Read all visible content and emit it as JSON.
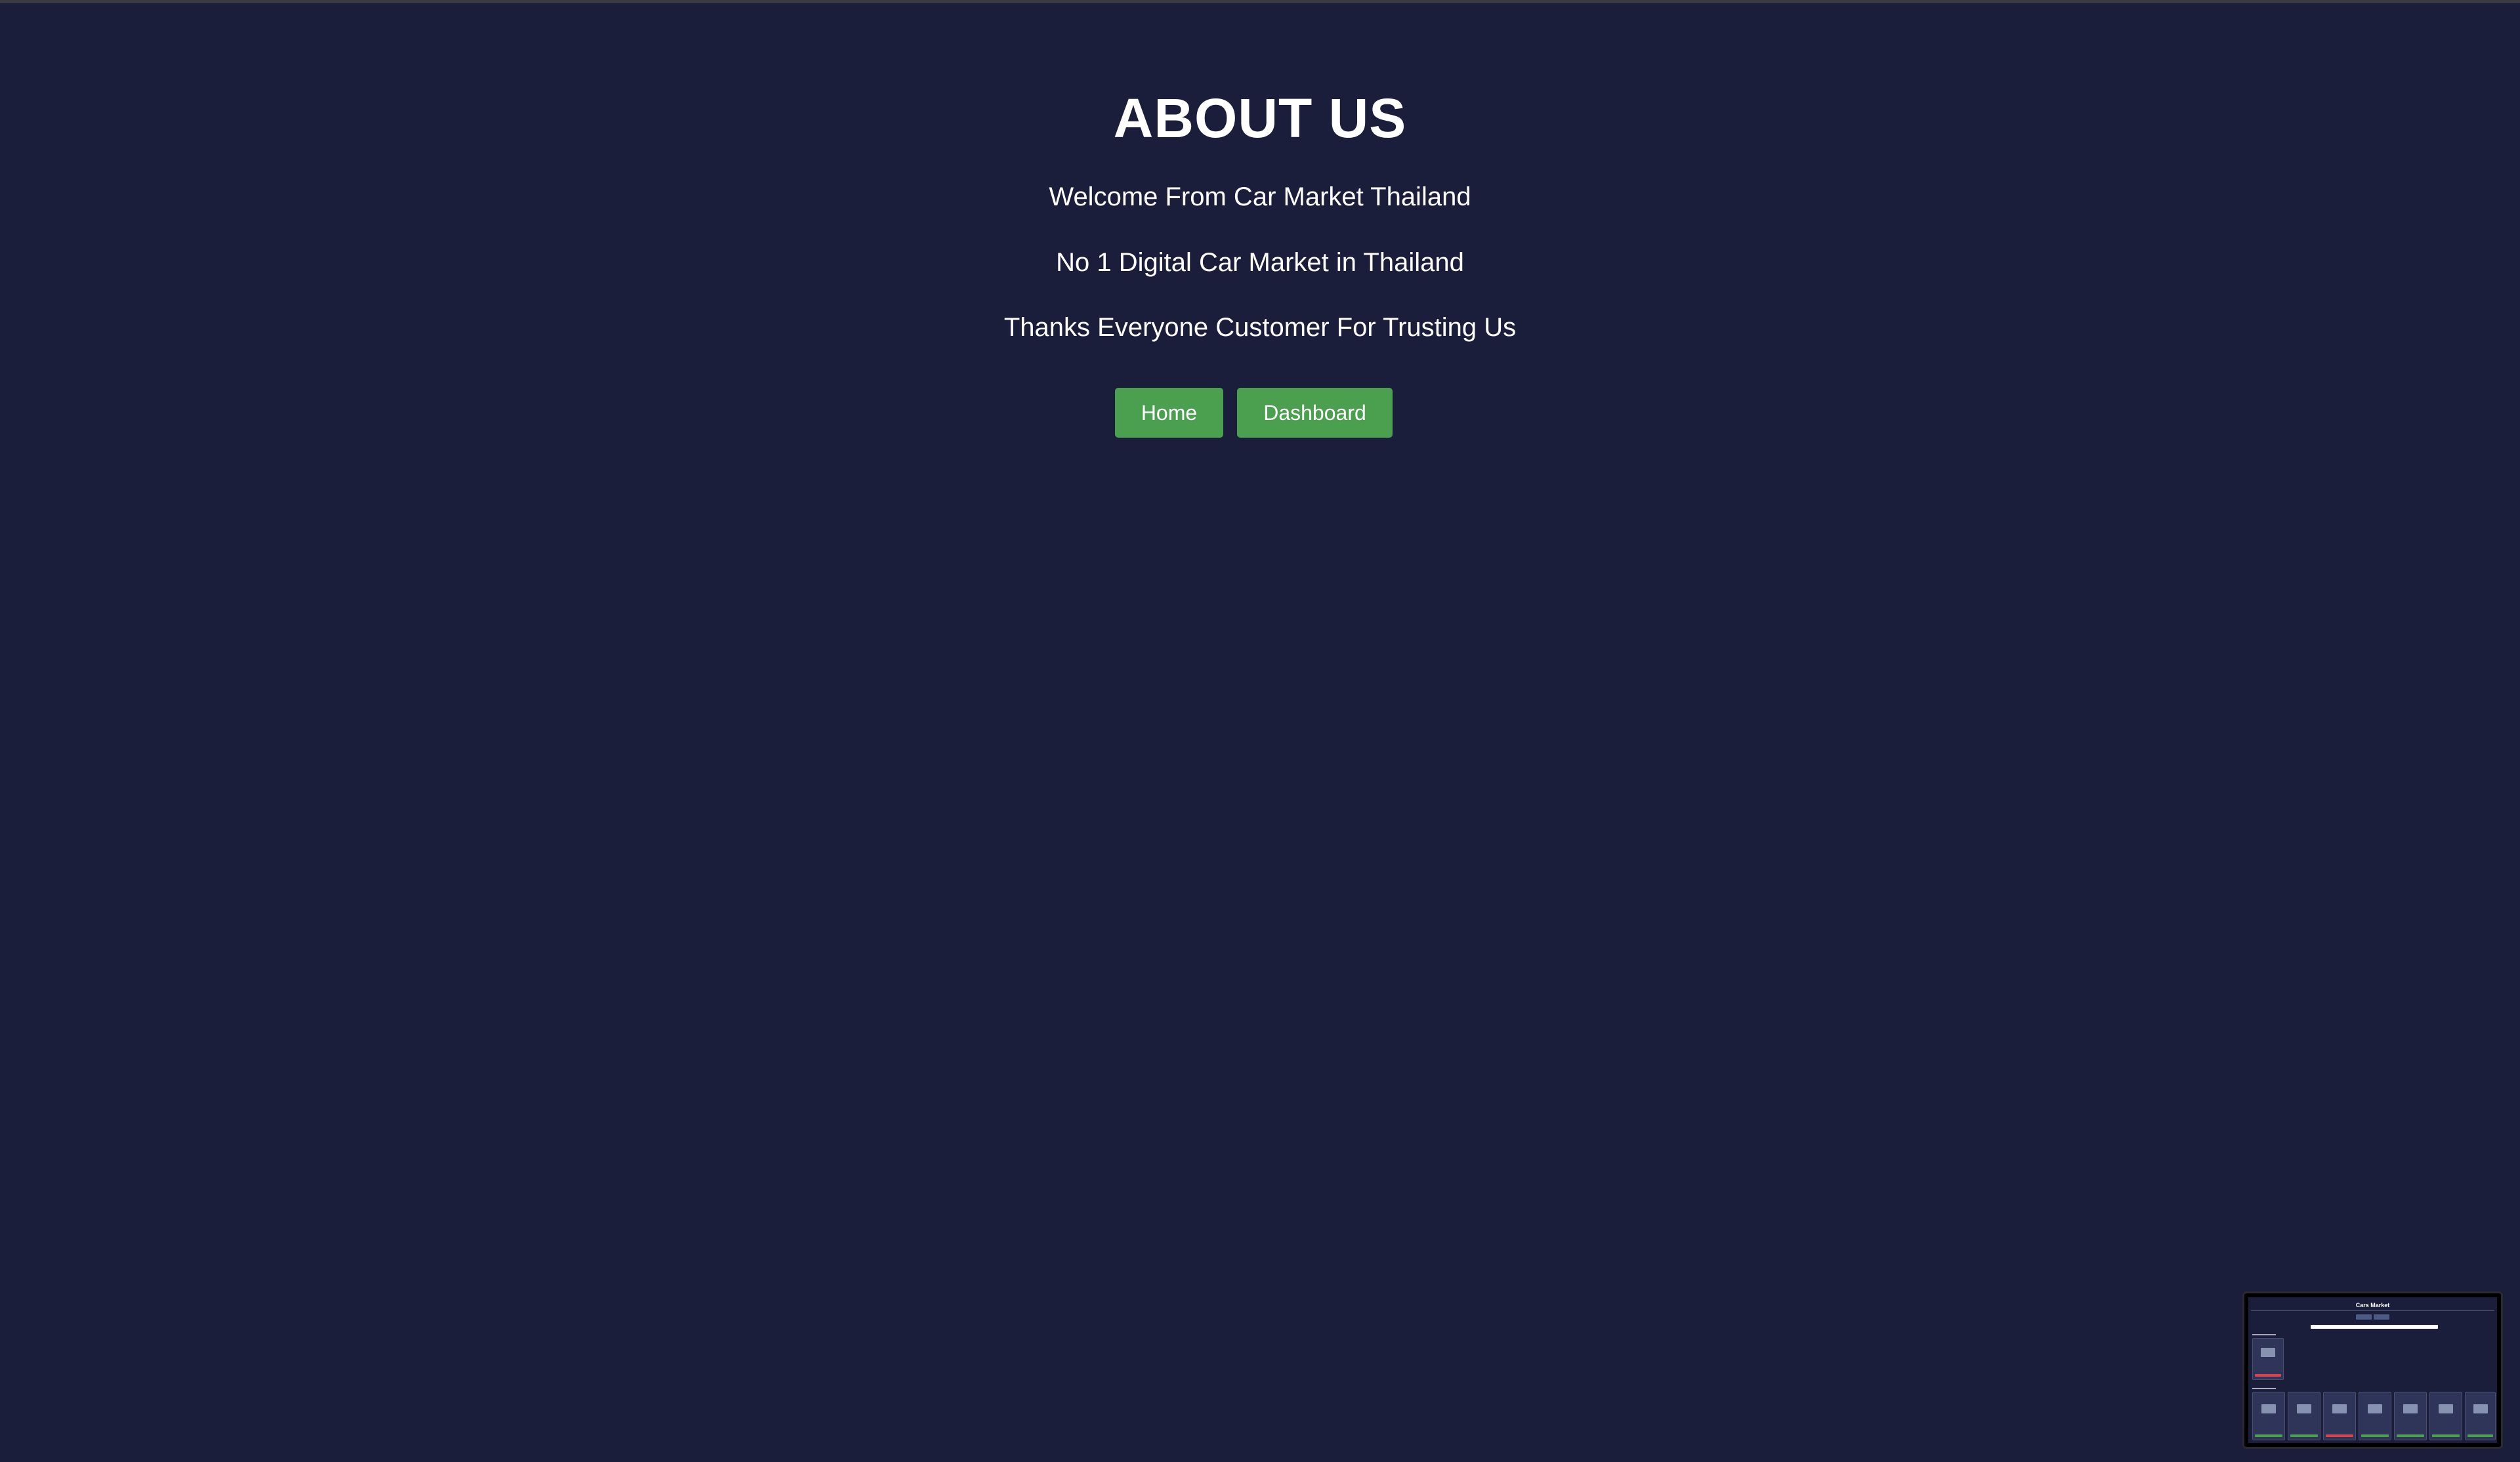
{
  "about": {
    "title": "ABOUT US",
    "line1": "Welcome From Car Market Thailand",
    "line2": "No 1 Digital Car Market in Thailand",
    "line3": "Thanks Everyone Customer For Trusting Us"
  },
  "buttons": {
    "home_label": "Home",
    "dashboard_label": "Dashboard"
  },
  "thumbnail": {
    "title": "Cars Market"
  },
  "colors": {
    "background": "#1b1e3a",
    "button": "#4aa04e",
    "text": "#ffffff"
  }
}
